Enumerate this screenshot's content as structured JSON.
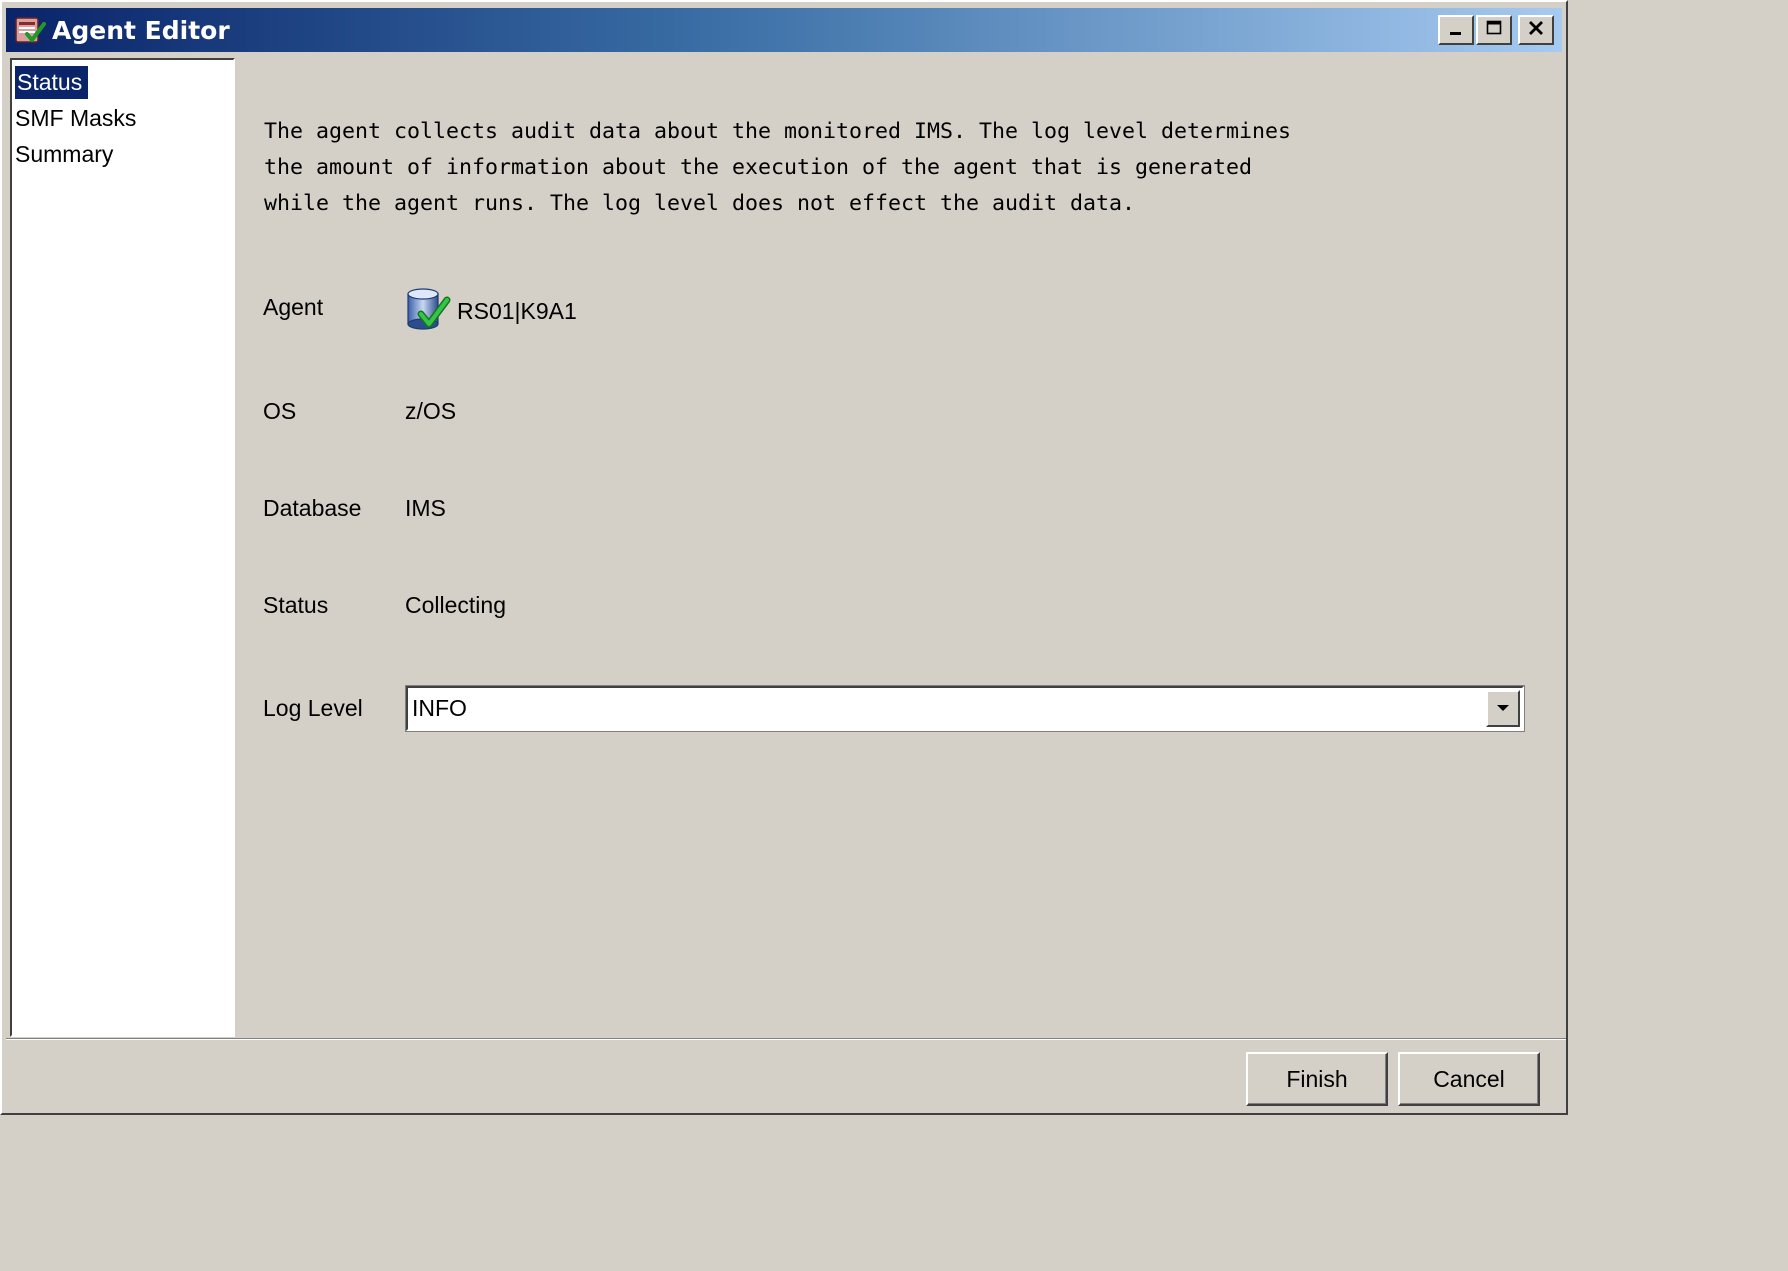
{
  "window": {
    "title": "Agent Editor",
    "title_icon": "agent-editor-icon"
  },
  "window_controls": {
    "minimize_icon": "minimize-icon",
    "maximize_icon": "maximize-icon",
    "close_icon": "close-icon"
  },
  "nav": {
    "items": [
      {
        "label": "Status",
        "selected": true
      },
      {
        "label": "SMF Masks",
        "selected": false
      },
      {
        "label": "Summary",
        "selected": false
      }
    ]
  },
  "main": {
    "description_lines": [
      "The agent collects audit data about the monitored IMS. The log level determines",
      "the amount of information about the execution of the agent that is generated",
      "while the agent runs. The log level does not effect the audit data."
    ],
    "fields": {
      "agent": {
        "label": "Agent",
        "value": "RS01|K9A1",
        "icon": "agent-status-ok-icon"
      },
      "os": {
        "label": "OS",
        "value": "z/OS"
      },
      "database": {
        "label": "Database",
        "value": "IMS"
      },
      "status": {
        "label": "Status",
        "value": "Collecting"
      },
      "log_level": {
        "label": "Log Level",
        "value": "INFO"
      }
    }
  },
  "buttons": {
    "finish": "Finish",
    "cancel": "Cancel"
  },
  "colors": {
    "title_gradient_start": "#0a246a",
    "title_gradient_end": "#a6caf0",
    "selection": "#0a246a",
    "window_bg": "#d4d0c8"
  }
}
